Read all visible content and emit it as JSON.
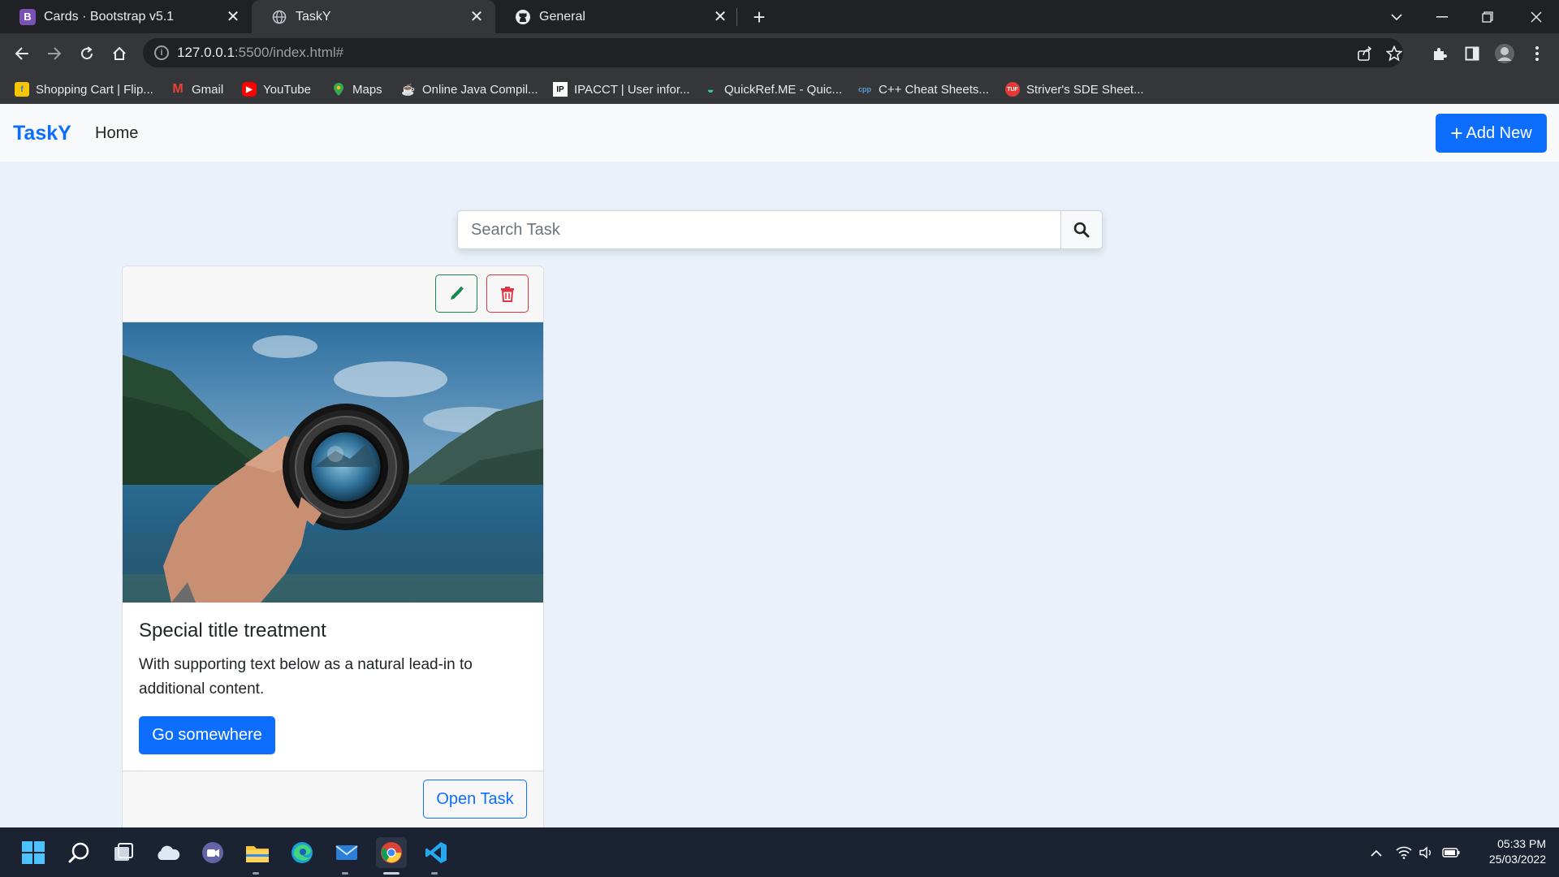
{
  "browser": {
    "tabs": [
      {
        "title": "Cards · Bootstrap v5.1",
        "icon": "bootstrap-icon",
        "favicon_text": "B",
        "active": false
      },
      {
        "title": "TaskY",
        "icon": "globe-icon",
        "active": true
      },
      {
        "title": "General",
        "icon": "github-icon",
        "active": false
      }
    ],
    "url_host": "127.0.0.1",
    "url_rest": ":5500/index.html#",
    "bookmarks": [
      {
        "label": "Shopping Cart | Flip...",
        "icon": "flipkart-icon"
      },
      {
        "label": "Gmail",
        "icon": "gmail-icon"
      },
      {
        "label": "YouTube",
        "icon": "youtube-icon"
      },
      {
        "label": "Maps",
        "icon": "maps-icon"
      },
      {
        "label": "Online Java Compil...",
        "icon": "java-icon"
      },
      {
        "label": "IPACCT | User infor...",
        "icon": "ipacct-icon"
      },
      {
        "label": "QuickRef.ME - Quic...",
        "icon": "quickref-icon"
      },
      {
        "label": "C++ Cheat Sheets...",
        "icon": "cpp-icon"
      },
      {
        "label": "Striver's SDE Sheet...",
        "icon": "tuf-icon"
      }
    ]
  },
  "page": {
    "brand": "TaskY",
    "nav_home": "Home",
    "add_new": "Add New",
    "search_placeholder": "Search Task",
    "card": {
      "title": "Special title treatment",
      "text": "With supporting text below as a natural lead-in to additional content.",
      "primary_button": "Go somewhere",
      "footer_button": "Open Task",
      "image_description": "hand holding a camera lens in front of a mountain lake"
    }
  },
  "taskbar": {
    "apps": [
      "windows-start-icon",
      "search-icon",
      "task-view-icon",
      "onedrive-icon",
      "teams-chat-icon",
      "file-explorer-icon",
      "edge-icon",
      "mail-icon",
      "chrome-icon",
      "vscode-icon"
    ],
    "time": "05:33 PM",
    "date": "25/03/2022"
  },
  "colors": {
    "primary": "#0d6efd",
    "success": "#198754",
    "danger": "#dc3545",
    "page_bg": "#eaf1fb"
  }
}
